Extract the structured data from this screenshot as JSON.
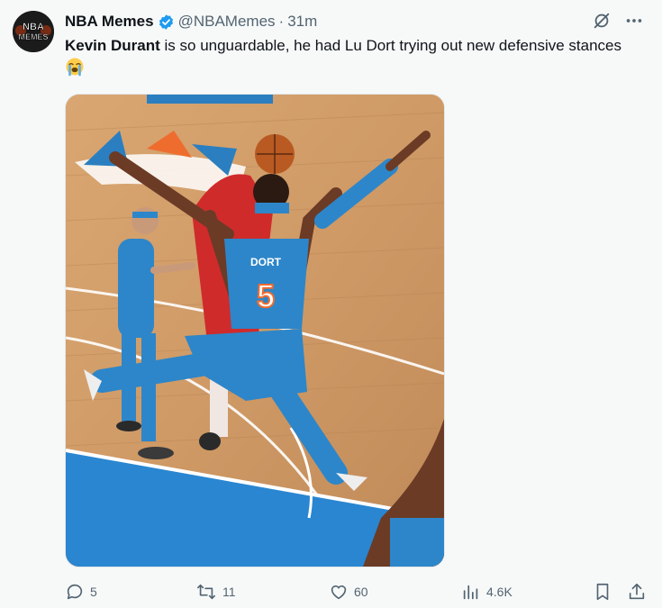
{
  "author": {
    "name": "NBA Memes",
    "handle": "@NBAMemes",
    "separator": "·",
    "time": "31m",
    "avatar_text_top": "NBA",
    "avatar_text_bottom": "MEMES"
  },
  "tweet": {
    "highlight": "Kevin Durant",
    "rest": " is so unguardable, he had Lu Dort trying out new defensive stances",
    "emoji_name": "loudly-crying-face-icon"
  },
  "media": {
    "jersey_name": "DORT",
    "jersey_number": "5"
  },
  "actions": {
    "replies": "5",
    "reposts": "11",
    "likes": "60",
    "views": "4.6K"
  },
  "colors": {
    "accent": "#1d9bf0",
    "muted": "#536471",
    "thunder_blue": "#2b7fc0",
    "court": "#c99462"
  }
}
